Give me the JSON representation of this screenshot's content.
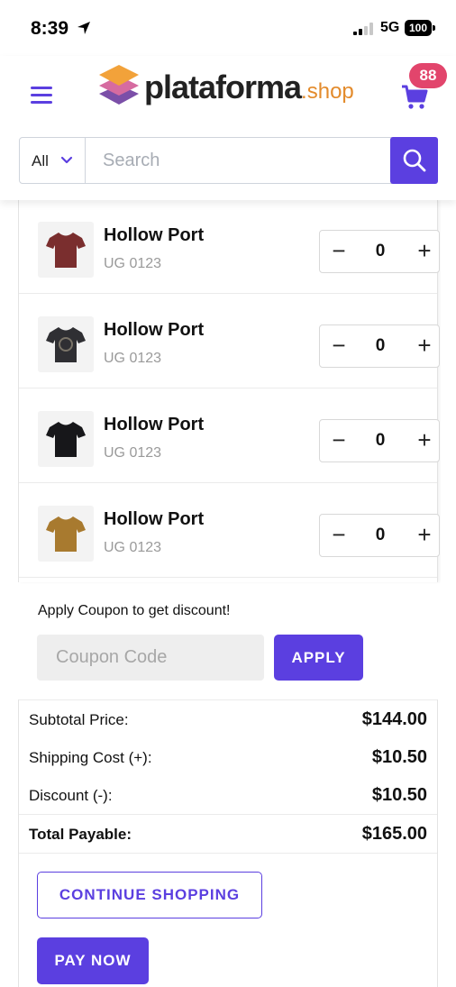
{
  "status_bar": {
    "time": "8:39",
    "network": "5G",
    "battery": "100"
  },
  "header": {
    "logo": {
      "main": "plataforma",
      "suffix": ".shop"
    },
    "cart_count": "88",
    "search": {
      "category": "All",
      "placeholder": "Search",
      "value": ""
    }
  },
  "cart": {
    "items": [
      {
        "name": "Hollow Port",
        "sku": "UG 0123",
        "qty": "0",
        "shirt_color": "#7a2e2e",
        "icon": "tshirt-icon"
      },
      {
        "name": "Hollow Port",
        "sku": "UG 0123",
        "qty": "0",
        "shirt_color": "#2f2f33",
        "icon": "tshirt-icon"
      },
      {
        "name": "Hollow Port",
        "sku": "UG 0123",
        "qty": "0",
        "shirt_color": "#17171a",
        "icon": "tshirt-icon"
      },
      {
        "name": "Hollow Port",
        "sku": "UG 0123",
        "qty": "0",
        "shirt_color": "#a87a2f",
        "icon": "tshirt-icon"
      }
    ],
    "stepper": {
      "minus": "−",
      "plus": "+"
    }
  },
  "coupon": {
    "label": "Apply Coupon to get discount!",
    "placeholder": "Coupon Code",
    "value": "",
    "apply_label": "APPLY"
  },
  "totals": {
    "subtotal_label": "Subtotal Price:",
    "subtotal_value": "$144.00",
    "shipping_label": "Shipping Cost (+):",
    "shipping_value": "$10.50",
    "discount_label": "Discount (-):",
    "discount_value": "$10.50",
    "payable_label": "Total Payable:",
    "payable_value": "$165.00"
  },
  "actions": {
    "continue_label": "CONTINUE SHOPPING",
    "pay_label": "PAY NOW"
  },
  "colors": {
    "accent": "#5b3fe0",
    "badge": "#e2456c",
    "logo_suffix": "#e38b2c"
  }
}
